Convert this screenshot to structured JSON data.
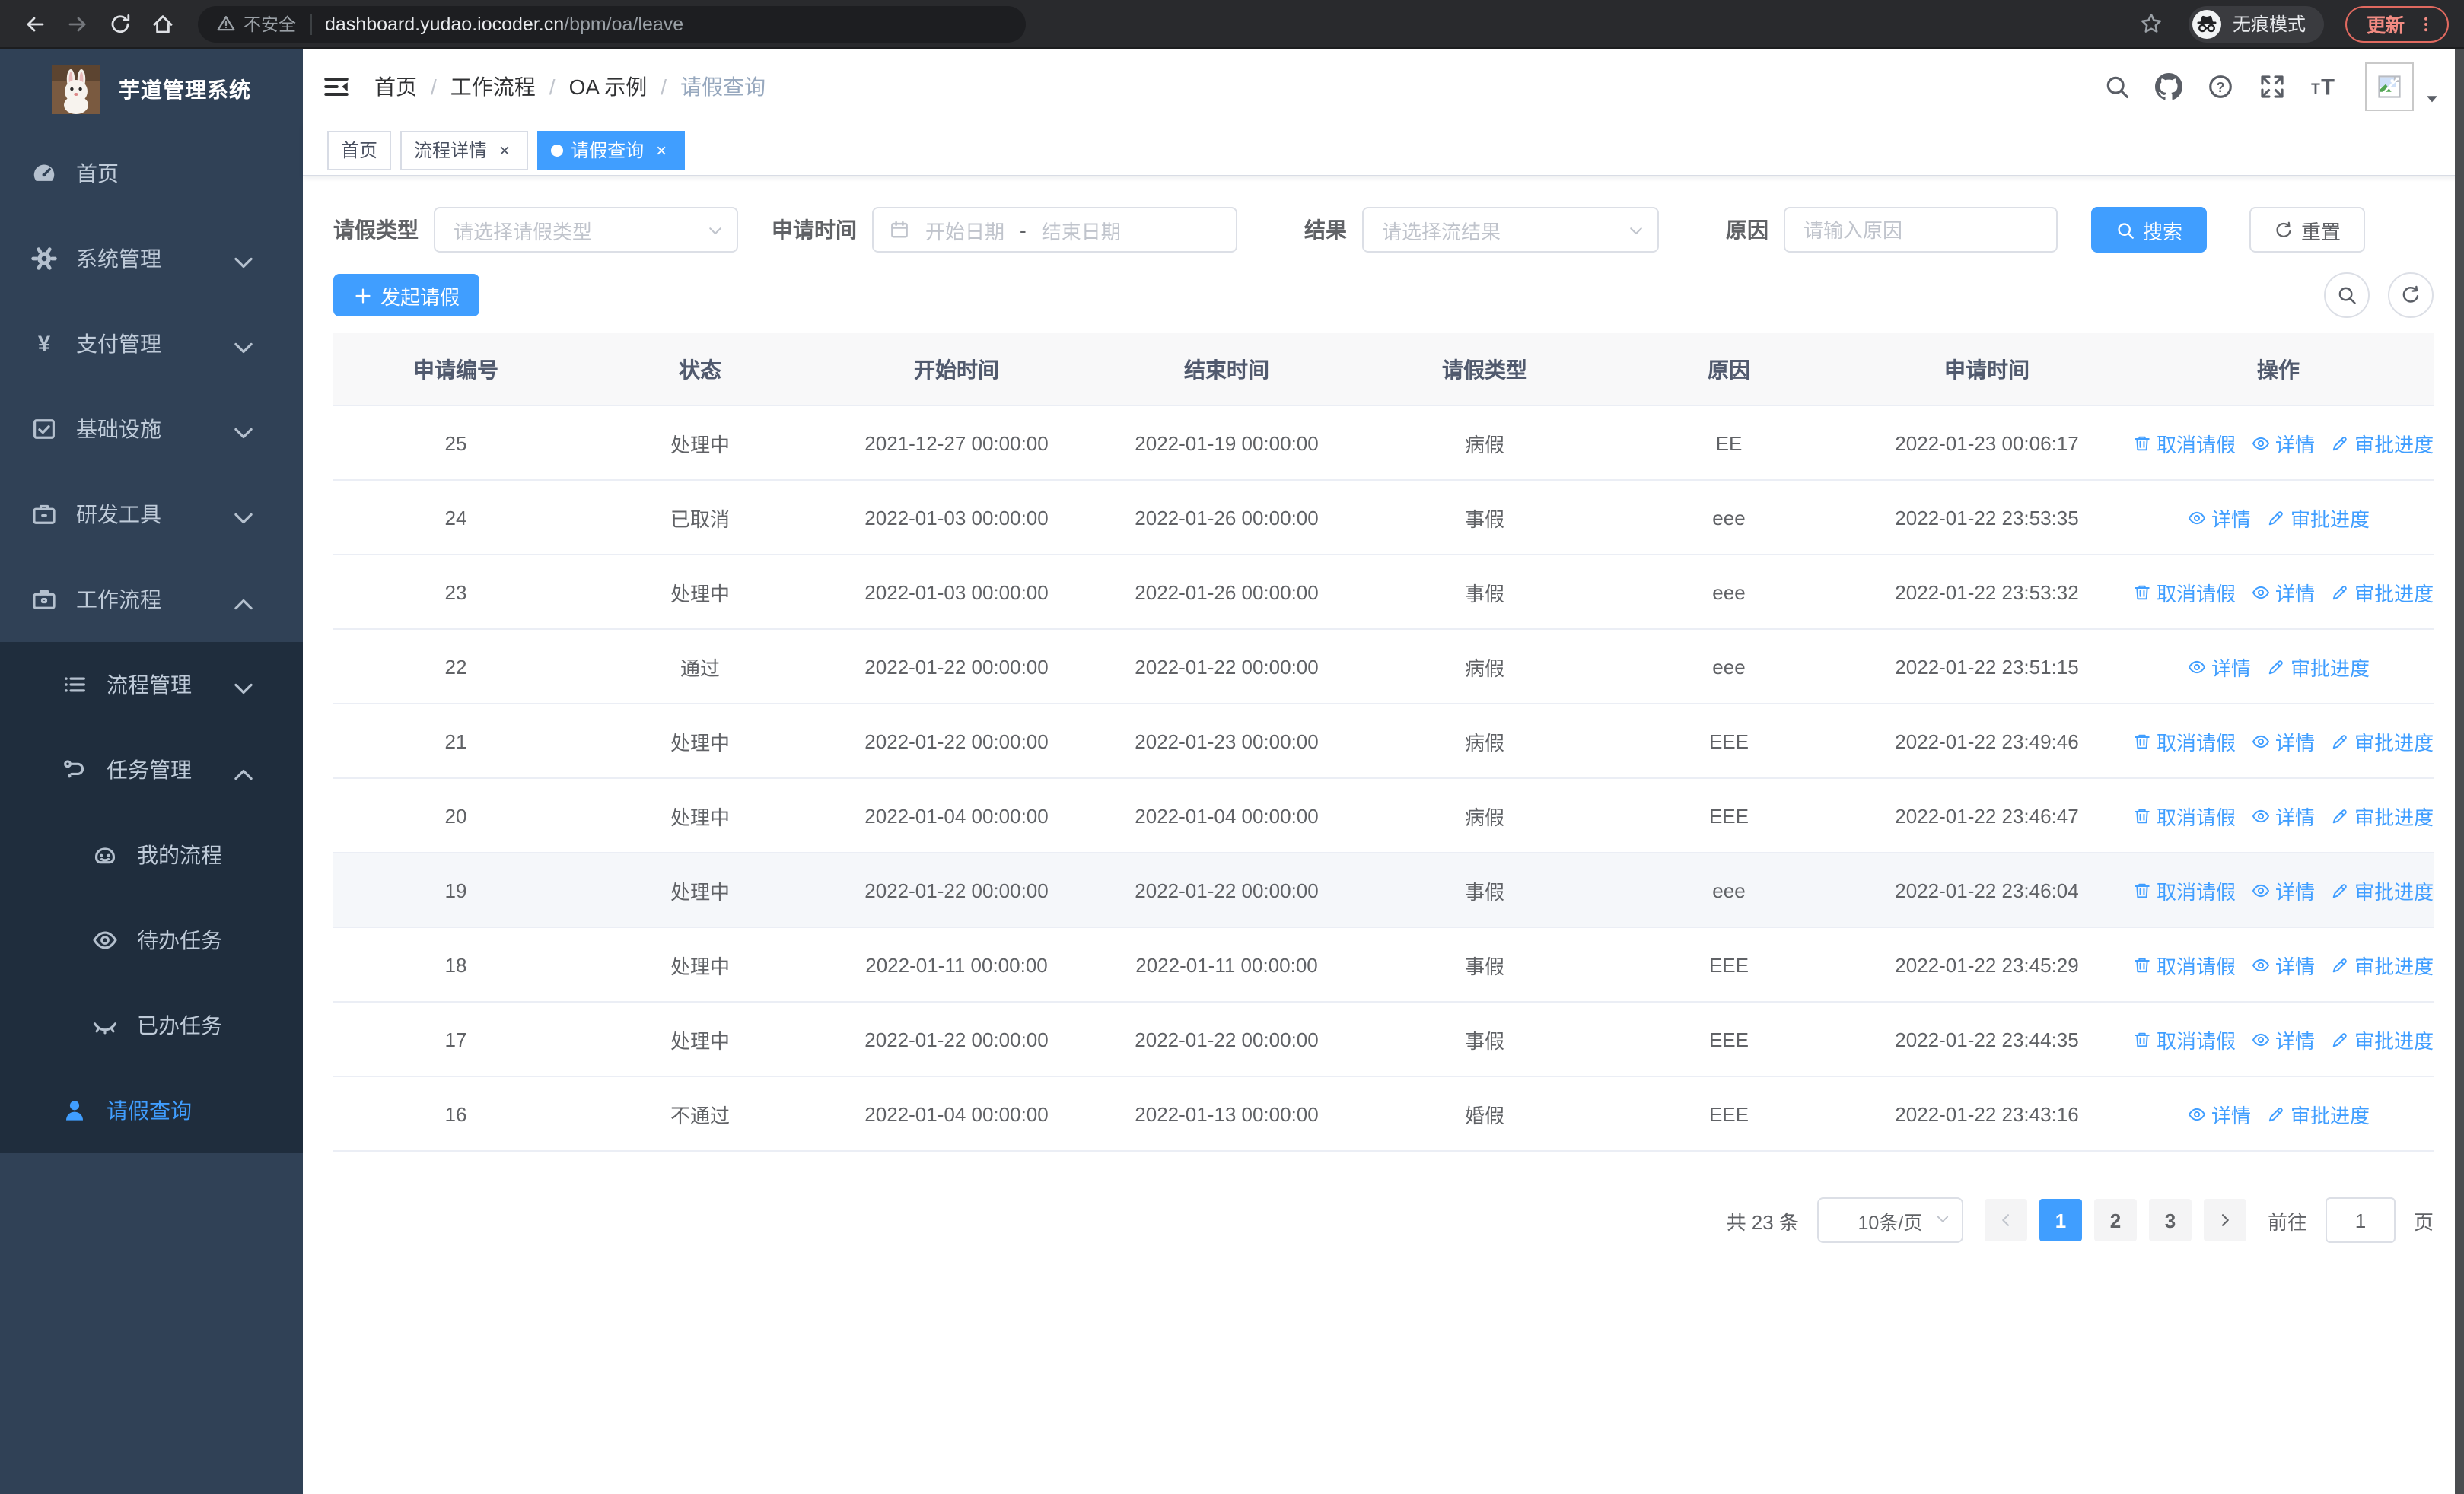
{
  "browser": {
    "security_label": "不安全",
    "url_host": "dashboard.yudao.iocoder.cn",
    "url_path": "/bpm/oa/leave",
    "incognito_label": "无痕模式",
    "update_label": "更新"
  },
  "sidebar": {
    "app_title": "芋道管理系统",
    "menu": [
      {
        "id": "home",
        "icon": "dashboard-icon",
        "label": "首页",
        "level": 1,
        "sub": false,
        "arrow": null,
        "active": false
      },
      {
        "id": "system",
        "icon": "gear-icon",
        "label": "系统管理",
        "level": 1,
        "sub": false,
        "arrow": "down",
        "active": false
      },
      {
        "id": "payment",
        "icon": "yen-icon",
        "label": "支付管理",
        "level": 1,
        "sub": false,
        "arrow": "down",
        "active": false
      },
      {
        "id": "infra",
        "icon": "infra-icon",
        "label": "基础设施",
        "level": 1,
        "sub": false,
        "arrow": "down",
        "active": false
      },
      {
        "id": "devtools",
        "icon": "toolbox-icon",
        "label": "研发工具",
        "level": 1,
        "sub": false,
        "arrow": "down",
        "active": false
      },
      {
        "id": "workflow",
        "icon": "briefcase-icon",
        "label": "工作流程",
        "level": 1,
        "sub": false,
        "arrow": "up",
        "active": false
      },
      {
        "id": "process-mgmt",
        "icon": "list-icon",
        "label": "流程管理",
        "level": 2,
        "sub": true,
        "arrow": "down",
        "active": false
      },
      {
        "id": "task-mgmt",
        "icon": "branch-icon",
        "label": "任务管理",
        "level": 2,
        "sub": true,
        "arrow": "up",
        "active": false
      },
      {
        "id": "my-process",
        "icon": "robot-icon",
        "label": "我的流程",
        "level": 3,
        "sub": true,
        "arrow": null,
        "active": false
      },
      {
        "id": "todo-task",
        "icon": "eye-icon",
        "label": "待办任务",
        "level": 3,
        "sub": true,
        "arrow": null,
        "active": false
      },
      {
        "id": "done-task",
        "icon": "eye-closed-icon",
        "label": "已办任务",
        "level": 3,
        "sub": true,
        "arrow": null,
        "active": false
      },
      {
        "id": "leave-query",
        "icon": "user-icon",
        "label": "请假查询",
        "level": 2,
        "sub": true,
        "arrow": null,
        "active": true
      }
    ]
  },
  "breadcrumb": [
    "首页",
    "工作流程",
    "OA 示例",
    "请假查询"
  ],
  "tabs": [
    {
      "label": "首页",
      "closable": false,
      "active": false
    },
    {
      "label": "流程详情",
      "closable": true,
      "active": false
    },
    {
      "label": "请假查询",
      "closable": true,
      "active": true
    }
  ],
  "filters": {
    "type_label": "请假类型",
    "type_placeholder": "请选择请假类型",
    "time_label": "申请时间",
    "time_start_placeholder": "开始日期",
    "time_separator": "-",
    "time_end_placeholder": "结束日期",
    "result_label": "结果",
    "result_placeholder": "请选择流结果",
    "reason_label": "原因",
    "reason_placeholder": "请输入原因",
    "search_label": "搜索",
    "reset_label": "重置"
  },
  "toolbar": {
    "create_label": "发起请假"
  },
  "table": {
    "columns": [
      "申请编号",
      "状态",
      "开始时间",
      "结束时间",
      "请假类型",
      "原因",
      "申请时间",
      "操作"
    ],
    "action_labels": {
      "cancel": "取消请假",
      "detail": "详情",
      "progress": "审批进度"
    },
    "rows": [
      {
        "id": "25",
        "status": "处理中",
        "start": "2021-12-27 00:00:00",
        "end": "2022-01-19 00:00:00",
        "type": "病假",
        "reason": "EE",
        "applied": "2022-01-23 00:06:17",
        "cancelable": true,
        "hovered": false
      },
      {
        "id": "24",
        "status": "已取消",
        "start": "2022-01-03 00:00:00",
        "end": "2022-01-26 00:00:00",
        "type": "事假",
        "reason": "eee",
        "applied": "2022-01-22 23:53:35",
        "cancelable": false,
        "hovered": false
      },
      {
        "id": "23",
        "status": "处理中",
        "start": "2022-01-03 00:00:00",
        "end": "2022-01-26 00:00:00",
        "type": "事假",
        "reason": "eee",
        "applied": "2022-01-22 23:53:32",
        "cancelable": true,
        "hovered": false
      },
      {
        "id": "22",
        "status": "通过",
        "start": "2022-01-22 00:00:00",
        "end": "2022-01-22 00:00:00",
        "type": "病假",
        "reason": "eee",
        "applied": "2022-01-22 23:51:15",
        "cancelable": false,
        "hovered": false
      },
      {
        "id": "21",
        "status": "处理中",
        "start": "2022-01-22 00:00:00",
        "end": "2022-01-23 00:00:00",
        "type": "病假",
        "reason": "EEE",
        "applied": "2022-01-22 23:49:46",
        "cancelable": true,
        "hovered": false
      },
      {
        "id": "20",
        "status": "处理中",
        "start": "2022-01-04 00:00:00",
        "end": "2022-01-04 00:00:00",
        "type": "病假",
        "reason": "EEE",
        "applied": "2022-01-22 23:46:47",
        "cancelable": true,
        "hovered": false
      },
      {
        "id": "19",
        "status": "处理中",
        "start": "2022-01-22 00:00:00",
        "end": "2022-01-22 00:00:00",
        "type": "事假",
        "reason": "eee",
        "applied": "2022-01-22 23:46:04",
        "cancelable": true,
        "hovered": true
      },
      {
        "id": "18",
        "status": "处理中",
        "start": "2022-01-11 00:00:00",
        "end": "2022-01-11 00:00:00",
        "type": "事假",
        "reason": "EEE",
        "applied": "2022-01-22 23:45:29",
        "cancelable": true,
        "hovered": false
      },
      {
        "id": "17",
        "status": "处理中",
        "start": "2022-01-22 00:00:00",
        "end": "2022-01-22 00:00:00",
        "type": "事假",
        "reason": "EEE",
        "applied": "2022-01-22 23:44:35",
        "cancelable": true,
        "hovered": false
      },
      {
        "id": "16",
        "status": "不通过",
        "start": "2022-01-04 00:00:00",
        "end": "2022-01-13 00:00:00",
        "type": "婚假",
        "reason": "EEE",
        "applied": "2022-01-22 23:43:16",
        "cancelable": false,
        "hovered": false
      }
    ]
  },
  "pagination": {
    "total": "共 23 条",
    "page_size": "10条/页",
    "pages": [
      "1",
      "2",
      "3"
    ],
    "active_page": "1",
    "goto_label": "前往",
    "goto_value": "1",
    "unit": "页"
  },
  "colors": {
    "accent": "#409eff",
    "sidebar_bg": "#304156",
    "submenu_bg": "#1f2d3d",
    "update_red": "#f28b82"
  }
}
